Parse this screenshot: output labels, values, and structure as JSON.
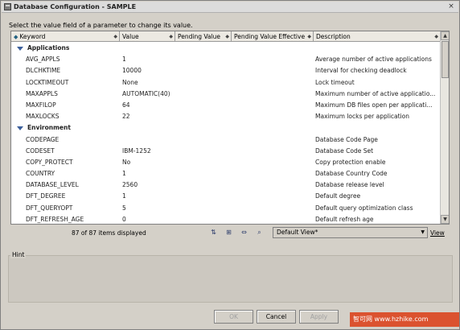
{
  "window": {
    "title": "Database Configuration - SAMPLE",
    "close_label": "×"
  },
  "instruction": "Select the value field of a parameter to change its value.",
  "table": {
    "headers": [
      {
        "label": "Keyword"
      },
      {
        "label": "Value"
      },
      {
        "label": "Pending Value"
      },
      {
        "label": "Pending Value Effective"
      },
      {
        "label": "Description"
      }
    ],
    "rows": [
      {
        "group": true,
        "keyword": "Applications",
        "value": "",
        "desc": ""
      },
      {
        "keyword": "AVG_APPLS",
        "value": "1",
        "desc": "Average number of active applications"
      },
      {
        "keyword": "DLCHKTIME",
        "value": "10000",
        "desc": "Interval for checking deadlock"
      },
      {
        "keyword": "LOCKTIMEOUT",
        "value": "None",
        "desc": "Lock timeout"
      },
      {
        "keyword": "MAXAPPLS",
        "value": "AUTOMATIC(40)",
        "desc": "Maximum number of active applicatio..."
      },
      {
        "keyword": "MAXFILOP",
        "value": "64",
        "desc": "Maximum DB files open per applicati..."
      },
      {
        "keyword": "MAXLOCKS",
        "value": "22",
        "desc": "Maximum locks per application"
      },
      {
        "group": true,
        "keyword": "Environment",
        "value": "",
        "desc": ""
      },
      {
        "keyword": "CODEPAGE",
        "value": "",
        "desc": "Database Code Page"
      },
      {
        "keyword": "CODESET",
        "value": "IBM-1252",
        "desc": "Database Code Set"
      },
      {
        "keyword": "COPY_PROTECT",
        "value": "No",
        "desc": "Copy protection enable"
      },
      {
        "keyword": "COUNTRY",
        "value": "1",
        "desc": "Database Country Code"
      },
      {
        "keyword": "DATABASE_LEVEL",
        "value": "2560",
        "desc": "Database release level"
      },
      {
        "keyword": "DFT_DEGREE",
        "value": "1",
        "desc": "Default degree"
      },
      {
        "keyword": "DFT_QUERYOPT",
        "value": "5",
        "desc": "Default query optimization class"
      },
      {
        "keyword": "DFT_REFRESH_AGE",
        "value": "0",
        "desc": "Default refresh age"
      }
    ]
  },
  "status": {
    "count": "87 of 87 items displayed",
    "view_selected": "Default View*",
    "view_link": "View"
  },
  "tool_icons": [
    "sort-icon",
    "filter-icon",
    "columns-icon",
    "find-icon"
  ],
  "hint": {
    "label": "Hint"
  },
  "buttons": {
    "ok": "OK",
    "cancel": "Cancel",
    "apply": "Apply"
  },
  "watermark": "智可网 www.hzhike.com",
  "colors": {
    "group_triangle": "#3b5f9b",
    "window_bg": "#d4d0c8"
  }
}
